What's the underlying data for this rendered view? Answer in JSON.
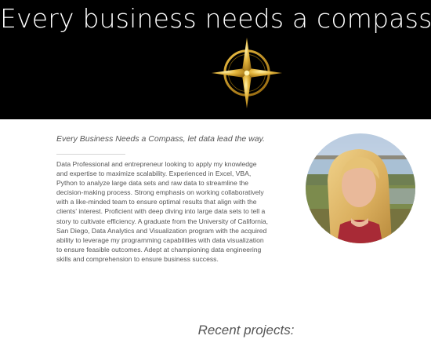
{
  "hero": {
    "title": "Every business needs a compass",
    "compass_icon": "compass-rose-icon",
    "accent_color": "#d4a72c"
  },
  "about": {
    "tagline": "Every Business Needs a Compass, let data lead the way.",
    "bio": "Data Professional and entrepreneur looking to apply my knowledge and expertise to maximize scalability. Experienced in Excel, VBA, Python to analyze large data sets and raw data to streamline the decision-making process. Strong emphasis on working collaboratively with a like-minded team to ensure optimal results that align with the clients' interest. Proficient with deep diving into large data sets to tell a story to cultivate efficiency. A graduate from the University of California, San Diego, Data Analytics and Visualization program with the acquired ability to leverage my programming capabilities with data visualization to ensure feasible outcomes. Adept at championing data engineering skills and comprehension to ensure business success."
  },
  "projects": {
    "heading": "Recent projects:"
  }
}
